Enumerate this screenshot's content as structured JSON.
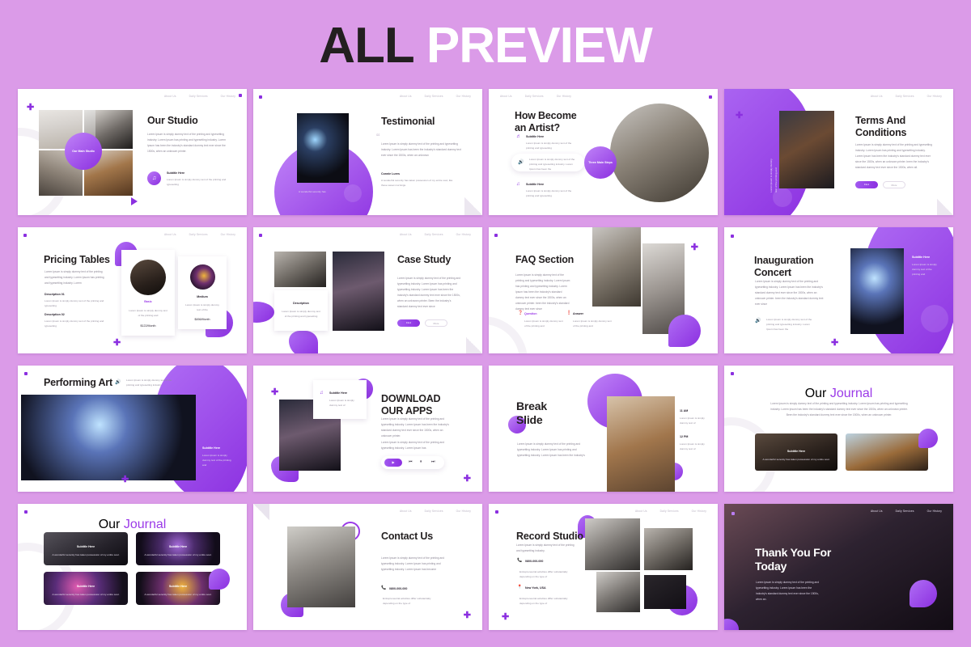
{
  "header": {
    "title_dark": "ALL",
    "title_light": "PREVIEW"
  },
  "theme": {
    "background": "#db9be8",
    "accent": "#8b2fe0",
    "accent_light": "#c084f8",
    "dark": "#231f20"
  },
  "nav": {
    "items": [
      "About Us",
      "Daily Services",
      "Our History"
    ]
  },
  "common": {
    "lorem_long": "Lorem Ipsum is simply dummy text of the printing and typesetting industry. Lorem Ipsum has printing and typesetting industry. Lorem Ipsum has been the industry's standard dummy text ever since the 1500s, when an unknown printer.",
    "lorem_mid": "Lorem Ipsum is simply dummy text of the printing and typesetting industry. Lorem Ipsum has printing and typesetting industry. Lorem",
    "lorem_short": "Lorem Ipsum is simply dummy text of the printing and typesetting",
    "lorem_xshort": "Lorem Ipsum is simply dummy text of",
    "subtitle_here": "Subtitle Here",
    "btn_find": "Find",
    "btn_more": "More",
    "card_caption": "A wonderful serenity has taken possession of my entire soul.",
    "description_label": "Description"
  },
  "slides": [
    {
      "id": 1,
      "name": "our-studio",
      "title": "Our Studio",
      "badge": "Our Main Studio",
      "body": "Lorem Ipsum is simply dummy text of the printing and typesetting industry. Lorem Ipsum has printing and typesetting industry. Lorem Ipsum has been the industry's standard dummy text ever since the 1500s, when an unknown printer.",
      "feature_title": "Subtitle Here",
      "feature_body": "Lorem Ipsum is simply dummy text of the printing and typesetting",
      "icon": "music-note-icon"
    },
    {
      "id": 2,
      "name": "testimonial",
      "title": "Testimonial",
      "quote_mark": "“",
      "body": "Lorem Ipsum is simply dummy text of the printing and typesetting industry. Lorem Ipsum has been the industry's standard dummy text ever since the 1500s, when an unknown",
      "author": "Connie Lures",
      "author_body": "A wonderful serenity has taken possession of my entire soul, like these sweet mornings.",
      "image_caption": "A wonderful serenity has"
    },
    {
      "id": 3,
      "name": "how-become-an-artist",
      "title": "How Become an Artist?",
      "badge": "Three Main Steps",
      "items": [
        {
          "title": "Subtitle Here",
          "body": "Lorem Ipsum is simply dummy text of the printing and typesetting",
          "icon": "headphone-icon"
        },
        {
          "title": "",
          "body": "Lorem Ipsum is simply dummy text of the printing and typesetting industry. Lorem Ipsum has been the",
          "icon": "speaker-icon"
        },
        {
          "title": "Subtitle Here",
          "body": "Lorem Ipsum is simply dummy text of the printing and typesetting",
          "icon": "music-note-icon"
        }
      ]
    },
    {
      "id": 4,
      "name": "terms-and-conditions",
      "title": "Terms And Conditions",
      "body": "Lorem Ipsum is simply dummy text of the printing and typesetting industry. Lorem Ipsum has printing and typesetting industry. Lorem Ipsum has been the industry's standard dummy text ever since the 1500s, when an unknown printer. been the industry's standard dummy text ever since the 1500s, when all.",
      "vertical_text": "Lorem Ipsum is simply dummy text of the printing and",
      "buttons": [
        "Find",
        "More"
      ]
    },
    {
      "id": 5,
      "name": "pricing-tables",
      "title": "Pricing Tables",
      "body": "Lorem Ipsum is simply dummy text of the printing and typesetting industry. Lorem Ipsum has printing and typesetting industry. Lorem",
      "features": [
        {
          "title": "Description 01",
          "body": "Lorem Ipsum is simply dummy text of the printing and typesetting"
        },
        {
          "title": "Description 02",
          "body": "Lorem Ipsum is simply dummy text of the printing and typesetting"
        }
      ],
      "plans": [
        {
          "name": "Basic",
          "body": "Lorem Ipsum is simply dummy text of the printing and",
          "price": "$122/Month"
        },
        {
          "name": "Medium",
          "body": "Lorem Ipsum is simply dummy text of the",
          "price": "$456/Month"
        }
      ]
    },
    {
      "id": 6,
      "name": "case-study",
      "title": "Case Study",
      "body": "Lorem Ipsum is simply dummy text of the printing and typesetting industry. Lorem Ipsum has printing and typesetting industry. Lorem Ipsum has been the industry's standard dummy text ever since the 1500s, when an unknown printer. Been the industry's standard dummy text ever since",
      "card_title": "Description",
      "card_body": "Lorem Ipsum is simply dummy text of the printing and typesetting",
      "buttons": [
        "Find",
        "More"
      ]
    },
    {
      "id": 7,
      "name": "faq-section",
      "title": "FAQ Section",
      "body": "Lorem Ipsum is simply dummy text of the printing and typesetting industry. Lorem Ipsum has printing and typesetting industry. Lorem Ipsum has been the industry's standard dummy text ever since the 1500s, when an unknown printer. been the industry's standard dummy text ever since",
      "qa": [
        {
          "label": "Question",
          "body": "Lorem Ipsum is simply dummy text of the printing and",
          "icon": "question-icon"
        },
        {
          "label": "Answer",
          "body": "Lorem Ipsum is simply dummy text of the printing and",
          "icon": "answer-icon"
        }
      ]
    },
    {
      "id": 8,
      "name": "inauguration-concert",
      "title": "Inauguration Concert",
      "body": "Lorem Ipsum is simply dummy text of the printing and typesetting industry. Lorem Ipsum has been the industry's standard dummy text ever since the 1500s, when an unknown printer. been the industry's standard dummy text ever since",
      "feature_body": "Lorem Ipsum is simply dummy text of the printing and typesetting industry. Lorem Ipsum has been the",
      "panel_title": "Subtitle Here",
      "panel_body": "Lorem Ipsum is simply dummy text of the printing and"
    },
    {
      "id": 9,
      "name": "performing-art",
      "title": "Performing Art",
      "header_body": "Lorem Ipsum is simply dummy text of the printing and typesetting industry",
      "panel_title": "Subtitle Here",
      "panel_body": "Lorem Ipsum is simply dummy text of the printing and"
    },
    {
      "id": 10,
      "name": "download-our-apps",
      "title": "DOWNLOAD OUR APPS",
      "card_title": "Subtitle Here",
      "card_body": "Lorem Ipsum is simply dummy text of",
      "body1": "Lorem Ipsum is simply dummy text of the printing and typesetting industry. Lorem Ipsum has been the industry's standard dummy text ever since the 1500s, when an unknown printer.",
      "body2": "Lorem Ipsum is simply dummy text of the printing and typesetting industry. Lorem Ipsum has",
      "player_controls": [
        "play-icon",
        "prev-icon",
        "pause-icon",
        "next-icon"
      ]
    },
    {
      "id": 11,
      "name": "break-slide",
      "title": "Break Slide",
      "body": "Lorem Ipsum is simply dummy text of the printing and typesetting industry. Lorem Ipsum has printing and typesetting industry. Lorem Ipsum has been the industry's",
      "schedule": [
        {
          "time": "11 AM",
          "body": "Lorem Ipsum is simply dummy text of"
        },
        {
          "time": "12 PM",
          "body": "Lorem Ipsum is simply dummy text of"
        }
      ]
    },
    {
      "id": 12,
      "name": "our-journal-two-cards",
      "title_dark": "Our",
      "title_accent": "Journal",
      "body": "Lorem Ipsum is simply dummy text of the printing and typesetting industry. Lorem Ipsum has printing and typesetting industry. Lorem Ipsum has been the industry's standard dummy text ever since the 1500s, when an unknown printer. Been the industry's standard dummy text ever since the 1500s, when an unknown printer.",
      "cards": [
        {
          "title": "Subtitle Here",
          "body": "A wonderful serenity has taken possession of my entire soul."
        },
        {
          "title": "",
          "body": ""
        }
      ]
    },
    {
      "id": 13,
      "name": "our-journal-four-cards",
      "title_dark": "Our",
      "title_accent": "Journal",
      "cards": [
        {
          "title": "Subtitle Here",
          "body": "A wonderful serenity has taken possession of my entire soul."
        },
        {
          "title": "Subtitle Here",
          "body": "A wonderful serenity has taken possession of my entire soul."
        },
        {
          "title": "Subtitle Here",
          "body": "A wonderful serenity has taken possession of my entire soul."
        },
        {
          "title": "Subtitle Here",
          "body": "A wonderful serenity has taken possession of my entire soul."
        }
      ]
    },
    {
      "id": 14,
      "name": "contact-us",
      "title": "Contact Us",
      "body": "Lorem Ipsum is simply dummy text of the printing and typesetting industry. Lorem Ipsum has printing and typesetting industry. Lorem Ipsum has become",
      "phone": "0800-000-000",
      "phone_note": "Entrepreneurial activities differ substantially depending on the type of",
      "icon": "phone-icon"
    },
    {
      "id": 15,
      "name": "record-studio",
      "title": "Record Studio",
      "body": "Lorem Ipsum is simply dummy text of the printing and typesetting industry.",
      "contacts": [
        {
          "value": "0800-000-000",
          "note": "Entrepreneurial activities differ substantially depending on the type of",
          "icon": "phone-icon"
        },
        {
          "value": "New York, USA",
          "note": "Entrepreneurial activities differ substantially depending on the type of",
          "icon": "location-icon"
        }
      ]
    },
    {
      "id": 16,
      "name": "thank-you",
      "title": "Thank You For Today",
      "body": "Lorem Ipsum is simply dummy text of the printing and typesetting industry. Lorem Ipsum has been the industry's standard dummy text ever since the 1500s, when an."
    }
  ]
}
